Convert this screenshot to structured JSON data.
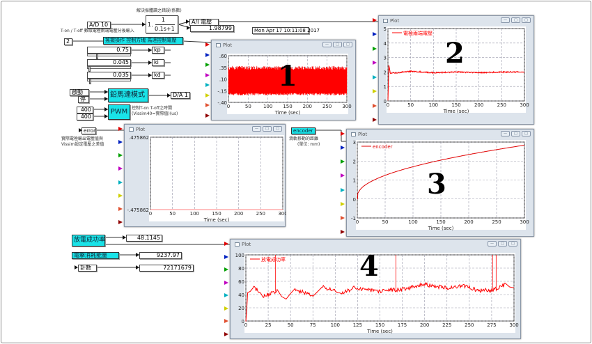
{
  "diagram": {
    "filter_note": "解決振體讀之錯誤(係數)",
    "ad_input": "A/D 10",
    "ad_note": "T-on / T-off 數取電極兩端電壓分後輸入",
    "tf_gain": "1.",
    "tf_num": "1",
    "tf_den": "0.1s+1",
    "ai_label": "A/I 電壓",
    "ai_value": "1.98799",
    "timestamp": "Mon Apr 17 10:11:08 2017",
    "const_2": "2",
    "control_block": "搖擺操作 控制方塊 馬達控制電壓",
    "sliders": [
      {
        "value": "0.75",
        "name": "kp"
      },
      {
        "value": "0.045",
        "name": "ki"
      },
      {
        "value": "0.035",
        "name": "kd"
      }
    ],
    "start_btn": "啟動",
    "stop_btn": "停",
    "motor_block": "鉛馬達模式",
    "da_output": "D/A 1",
    "pwm_in": [
      "400",
      "400"
    ],
    "pwm_block": "PWM",
    "pwm_note": [
      "控制T-on T-off之時間",
      "(Vissim40=實際值)(us)"
    ],
    "error_label": "error",
    "error_note": [
      "實際電極輸出電壓值與",
      "Vissim設定電壓之差值"
    ],
    "encoder_label": "encoder",
    "encoder_note": [
      "滑軌移動的距離",
      "(單位: mm)"
    ],
    "success_block": "放電成功率",
    "success_value": "48.1145",
    "energy_block": "電擊消耗能量",
    "energy_value": "9237.97",
    "count_block": "計數",
    "count_value": "72171679"
  },
  "window_title": "Plot",
  "port_colors": [
    "#e00000",
    "#0020c0",
    "#00a000",
    "#c000c0",
    "#00b0c0",
    "#d0d000",
    "#e05030",
    "#900000"
  ],
  "chart_data": [
    {
      "id": "plot1",
      "marker": "1",
      "type": "line",
      "xlabel": "Time (sec)",
      "xlim": [
        0,
        300
      ],
      "xticks": [
        0,
        50,
        100,
        150,
        200,
        250,
        300
      ],
      "ylim": [
        -0.4,
        0.6
      ],
      "yticks": [
        ".60",
        ".35",
        ".10",
        "-.15",
        "-.40"
      ],
      "ytick_values": [
        0.6,
        0.35,
        0.1,
        -0.15,
        -0.4
      ],
      "grid": true,
      "color": "#ff0000",
      "noise_band": [
        -0.25,
        0.38
      ]
    },
    {
      "id": "plot2",
      "marker": "2",
      "type": "line",
      "xlabel": "Time (sec)",
      "xlim": [
        0,
        300
      ],
      "xticks": [
        0,
        50,
        100,
        150,
        200,
        250,
        300
      ],
      "ylim": [
        0,
        5
      ],
      "yticks": [
        "0",
        "1",
        "2",
        "3",
        "4",
        "5"
      ],
      "ytick_values": [
        0,
        1,
        2,
        3,
        4,
        5
      ],
      "grid": true,
      "color": "#ff0000",
      "legend": "電極兩端電壓",
      "x": [
        0,
        2,
        5,
        50,
        100,
        150,
        200,
        250,
        300
      ],
      "y": [
        0,
        2.5,
        1.9,
        2.05,
        1.95,
        2.0,
        1.95,
        2.0,
        2.0
      ]
    },
    {
      "id": "plot_error",
      "marker": "",
      "type": "line",
      "xlabel": "Time (sec)",
      "xlim": [
        0,
        300
      ],
      "xticks": [
        0,
        50,
        100,
        150,
        200,
        250,
        300
      ],
      "ylim": [
        -0.475862,
        0.475862
      ],
      "yticks": [
        ".475862",
        "-.475862"
      ],
      "ytick_values": [
        0.475862,
        -0.475862
      ],
      "grid": true,
      "color": "#ff8080",
      "x": [
        0,
        300
      ],
      "y": [
        -0.475862,
        -0.475862
      ]
    },
    {
      "id": "plot3",
      "marker": "3",
      "type": "line",
      "xlabel": "Time (sec)",
      "xlim": [
        0,
        300
      ],
      "xticks": [
        0,
        50,
        100,
        150,
        200,
        250,
        300
      ],
      "ylim": [
        -1,
        3
      ],
      "yticks": [
        "3",
        "2",
        "1",
        "0",
        "-1"
      ],
      "ytick_values": [
        3,
        2,
        1,
        0,
        -1
      ],
      "grid": true,
      "color": "#e00000",
      "legend": "encoder",
      "x": [
        0,
        1,
        10,
        50,
        100,
        150,
        200,
        250,
        300
      ],
      "y": [
        0,
        0.15,
        0.45,
        0.95,
        1.4,
        1.8,
        2.15,
        2.45,
        2.75
      ]
    },
    {
      "id": "plot4",
      "marker": "4",
      "type": "line",
      "xlabel": "Time (sec)",
      "xlim": [
        0,
        300
      ],
      "xticks": [
        0,
        25,
        50,
        75,
        100,
        125,
        150,
        175,
        200,
        225,
        250,
        275,
        300
      ],
      "ylim": [
        0,
        100
      ],
      "yticks": [
        "0",
        "20",
        "40",
        "60",
        "80",
        "100"
      ],
      "ytick_values": [
        0,
        20,
        40,
        60,
        80,
        100
      ],
      "grid": true,
      "color": "#ff0000",
      "legend": "放電成功率",
      "x": [
        0,
        2,
        8,
        20,
        35,
        45,
        55,
        75,
        85,
        100,
        105,
        120,
        150,
        175,
        200,
        225,
        245,
        260,
        275,
        290,
        300
      ],
      "y": [
        0,
        40,
        52,
        38,
        45,
        35,
        48,
        38,
        52,
        45,
        40,
        50,
        45,
        48,
        55,
        50,
        53,
        46,
        47,
        55,
        50
      ],
      "spikes": [
        33,
        168,
        276,
        280
      ]
    }
  ]
}
